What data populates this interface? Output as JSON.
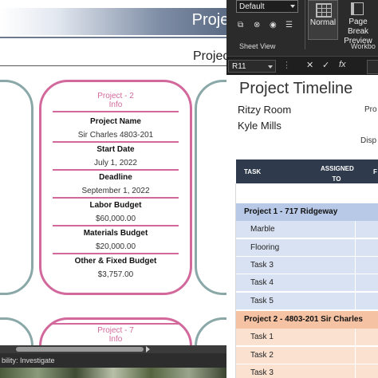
{
  "left_window": {
    "title": "Project O",
    "subtitle": "Projec",
    "card2": {
      "heading": "Project - 2",
      "heading_sub": "Info",
      "fields": [
        {
          "label": "Project Name",
          "value": "Sir Charles 4803-201"
        },
        {
          "label": "Start Date",
          "value": "July 1, 2022"
        },
        {
          "label": "Deadline",
          "value": "September 1, 2022"
        },
        {
          "label": "Labor Budget",
          "value": "$60,000.00"
        },
        {
          "label": "Materials Budget",
          "value": "$20,000.00"
        },
        {
          "label": "Other & Fixed Budget",
          "value": "$3,757.00"
        }
      ]
    },
    "card7": {
      "heading": "Project - 7",
      "heading_sub": "Info"
    },
    "status_text": "bility: Investigate"
  },
  "ribbon": {
    "view_select": "Default",
    "sheet_view_label": "Sheet View",
    "normal_label": "Normal",
    "page_break_label_1": "Page Break",
    "page_break_label_2": "Preview",
    "workbook_label": "Workbo"
  },
  "formula_bar": {
    "name_box": "R11",
    "cancel": "✕",
    "enter": "✓",
    "fx": "fx"
  },
  "sheet": {
    "title": "Project Timeline",
    "company": "Ritzy Room",
    "manager": "Kyle Mills",
    "right_label_1": "Pro",
    "right_label_2": "Disp",
    "header": {
      "task": "TASK",
      "assigned": "ASSIGNED TO",
      "f": "F"
    },
    "sections": [
      {
        "name": "Project 1 - 717 Ridgeway",
        "tasks": [
          "Marble",
          "Flooring",
          "Task 3",
          "Task 4",
          "Task 5"
        ]
      },
      {
        "name": "Project 2 - 4803-201 Sir Charles",
        "tasks": [
          "Task 1",
          "Task 2",
          "Task 3"
        ]
      }
    ]
  },
  "colors": {
    "pink": "#d2689b",
    "teal": "#8aa8a8",
    "header_dark": "#2f3b4c",
    "section_blue": "#b7c9e6",
    "section_orange": "#f5c3a3"
  }
}
